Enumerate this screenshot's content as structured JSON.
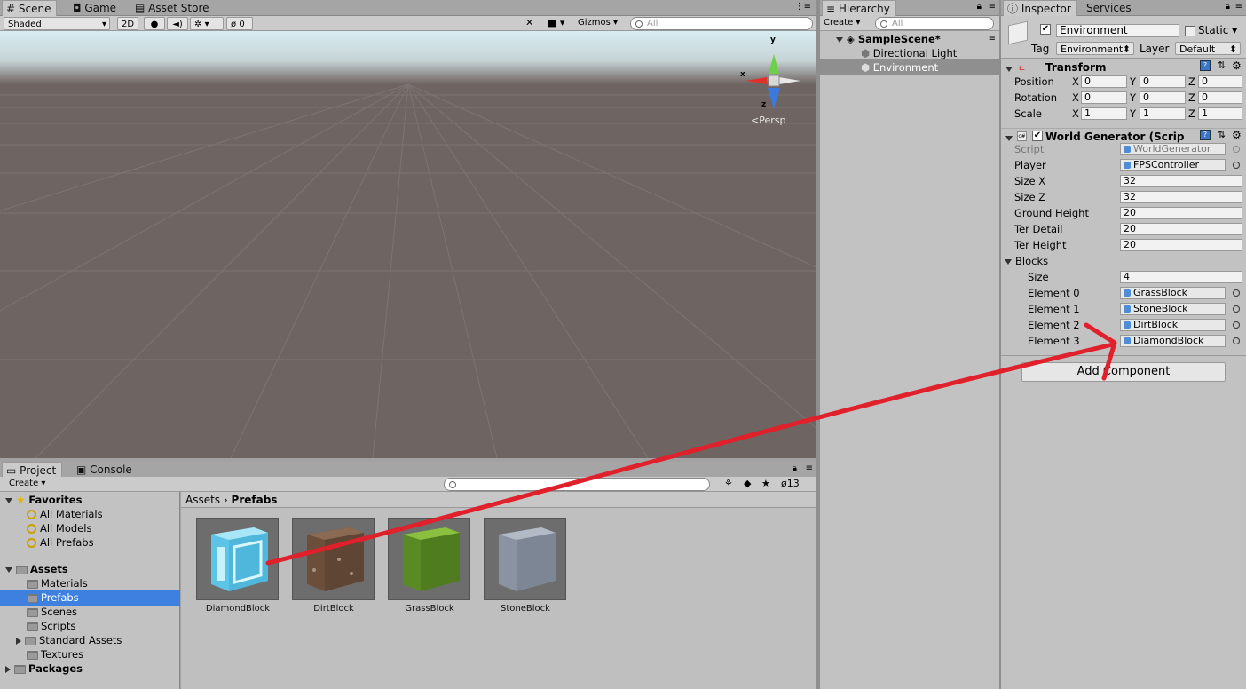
{
  "scene_tabs": [
    {
      "label": "Scene",
      "icon": "hash-icon"
    },
    {
      "label": "Game",
      "icon": "gamepad-icon"
    },
    {
      "label": "Asset Store",
      "icon": "store-icon"
    }
  ],
  "scene_toolbar": {
    "shading_mode": "Shaded",
    "mode_2d": "2D",
    "hidden_count": "0",
    "gizmos_label": "Gizmos",
    "search_placeholder": "All"
  },
  "viewport": {
    "persp_label": "Persp",
    "axis_x": "x",
    "axis_y": "y",
    "axis_z": "z"
  },
  "hierarchy": {
    "tab_label": "Hierarchy",
    "create_label": "Create",
    "search_placeholder": "All",
    "scene_name": "SampleScene*",
    "items": [
      "Directional Light",
      "Environment"
    ]
  },
  "inspector": {
    "tabs": [
      {
        "label": "Inspector"
      },
      {
        "label": "Services"
      }
    ],
    "object_name": "Environment",
    "static_label": "Static",
    "tag_label": "Tag",
    "tag_value": "Environment",
    "layer_label": "Layer",
    "layer_value": "Default",
    "transform": {
      "title": "Transform",
      "rows": [
        {
          "label": "Position",
          "x": "0",
          "y": "0",
          "z": "0"
        },
        {
          "label": "Rotation",
          "x": "0",
          "y": "0",
          "z": "0"
        },
        {
          "label": "Scale",
          "x": "1",
          "y": "1",
          "z": "1"
        }
      ],
      "x_label": "X",
      "y_label": "Y",
      "z_label": "Z"
    },
    "world_generator": {
      "title": "World Generator (Scrip",
      "script_label": "Script",
      "script_value": "WorldGenerator",
      "player_label": "Player",
      "player_value": "FPSController",
      "fields": [
        {
          "label": "Size X",
          "value": "32"
        },
        {
          "label": "Size Z",
          "value": "32"
        },
        {
          "label": "Ground Height",
          "value": "20"
        },
        {
          "label": "Ter Detail",
          "value": "20"
        },
        {
          "label": "Ter Height",
          "value": "20"
        }
      ],
      "blocks_label": "Blocks",
      "blocks_size_label": "Size",
      "blocks_size_value": "4",
      "elements": [
        {
          "label": "Element 0",
          "value": "GrassBlock"
        },
        {
          "label": "Element 1",
          "value": "StoneBlock"
        },
        {
          "label": "Element 2",
          "value": "DirtBlock"
        },
        {
          "label": "Element 3",
          "value": "DiamondBlock"
        }
      ]
    },
    "add_component": "Add Component"
  },
  "project": {
    "tabs": [
      {
        "label": "Project"
      },
      {
        "label": "Console"
      }
    ],
    "create_label": "Create",
    "hidden_count": "13",
    "favorites_label": "Favorites",
    "favorites": [
      "All Materials",
      "All Models",
      "All Prefabs"
    ],
    "assets_label": "Assets",
    "asset_folders": [
      "Materials",
      "Prefabs",
      "Scenes",
      "Scripts",
      "Standard Assets",
      "Textures"
    ],
    "packages_label": "Packages",
    "breadcrumb_root": "Assets",
    "breadcrumb_current": "Prefabs",
    "prefabs": [
      {
        "name": "DiamondBlock",
        "color": "#7fd3ee"
      },
      {
        "name": "DirtBlock",
        "color": "#7a5c43"
      },
      {
        "name": "GrassBlock",
        "color": "#5f8f2a"
      },
      {
        "name": "StoneBlock",
        "color": "#8d97a6"
      }
    ]
  },
  "colors": {
    "selection": "#3d80df",
    "annotation_arrow": "#e0202a",
    "scene_ground": "#6e6461"
  }
}
